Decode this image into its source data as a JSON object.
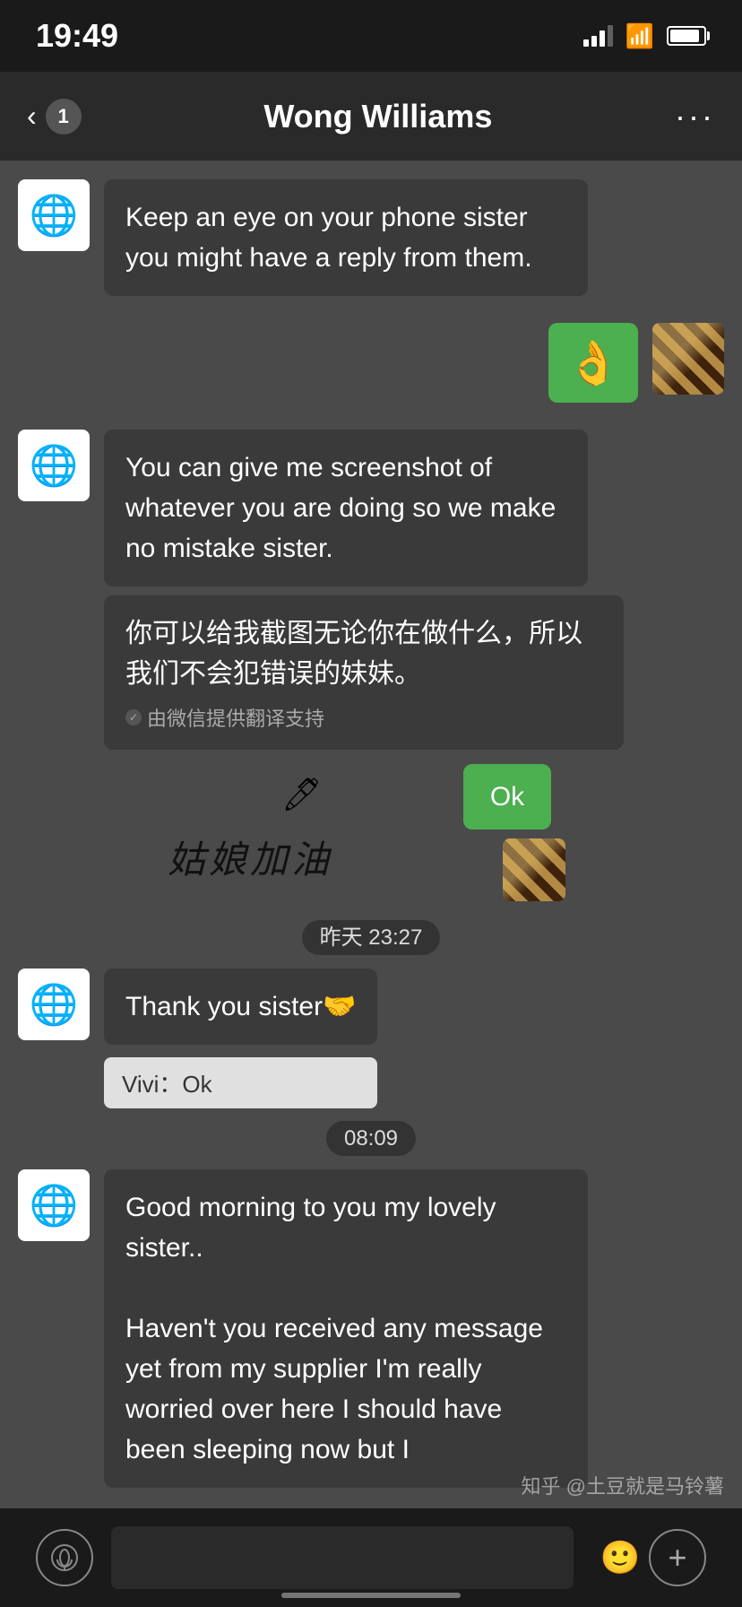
{
  "statusBar": {
    "time": "19:49",
    "signal": 3,
    "battery": 90
  },
  "header": {
    "back_label": "<",
    "badge": "1",
    "title": "Wong Williams",
    "more_label": "···"
  },
  "messages": [
    {
      "id": "msg1",
      "type": "received",
      "text": "Keep an eye on your phone sister you might have a reply from them.",
      "avatar": "🌐"
    },
    {
      "id": "msg2",
      "type": "sent_emoji",
      "text": "👌"
    },
    {
      "id": "msg3",
      "type": "received",
      "text": "You can give me screenshot of whatever you are doing so we make no mistake sister.",
      "avatar": "🌐"
    },
    {
      "id": "msg3_trans",
      "type": "translation",
      "text": "你可以给我截图无论你在做什么，所以我们不会犯错误的妹妹。",
      "note": "由微信提供翻译支持"
    },
    {
      "id": "msg4",
      "type": "sent_ok",
      "text": "Ok"
    },
    {
      "id": "divider1",
      "type": "divider",
      "text": "昨天 23:27"
    },
    {
      "id": "msg5",
      "type": "received_with_reply",
      "text": "Thank you sister🤝",
      "avatar": "🌐",
      "reply": "Vivi：Ok"
    },
    {
      "id": "divider2",
      "type": "divider",
      "text": "08:09"
    },
    {
      "id": "msg6",
      "type": "received",
      "text": "Good morning to you my lovely sister..\n\nHaven't you received any message yet from my supplier I'm really worried over here I should have been sleeping now but I",
      "avatar": "🌐"
    }
  ],
  "bottomBar": {
    "voice_label": "voice",
    "emoji_label": "emoji",
    "add_label": "add"
  },
  "watermark": "知乎 @土豆就是马铃薯"
}
